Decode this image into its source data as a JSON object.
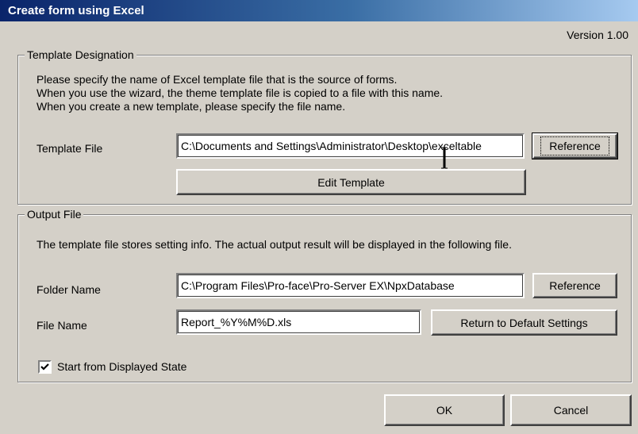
{
  "window": {
    "title": "Create form using Excel"
  },
  "version": "Version 1.00",
  "template_group": {
    "legend": "Template Designation",
    "lines": [
      "Please specify the name of Excel template file that is the source of forms.",
      "When you use the wizard, the theme template file is copied to a file with this name.",
      "When you create a new template, please specify the file name."
    ],
    "file_label": "Template File",
    "file_value": "C:\\Documents and Settings\\Administrator\\Desktop\\exceltable",
    "reference_label": "Reference",
    "edit_label": "Edit Template"
  },
  "output_group": {
    "legend": "Output File",
    "description": "The template file stores setting info. The actual output result will be displayed in the following file.",
    "folder_label": "Folder Name",
    "folder_value": "C:\\Program Files\\Pro-face\\Pro-Server EX\\NpxDatabase",
    "folder_reference_label": "Reference",
    "file_label": "File Name",
    "file_value": "Report_%Y%M%D.xls",
    "default_label": "Return to Default Settings",
    "checkbox_label": "Start from Displayed State",
    "checkbox_checked": true
  },
  "footer": {
    "ok_label": "OK",
    "cancel_label": "Cancel"
  }
}
